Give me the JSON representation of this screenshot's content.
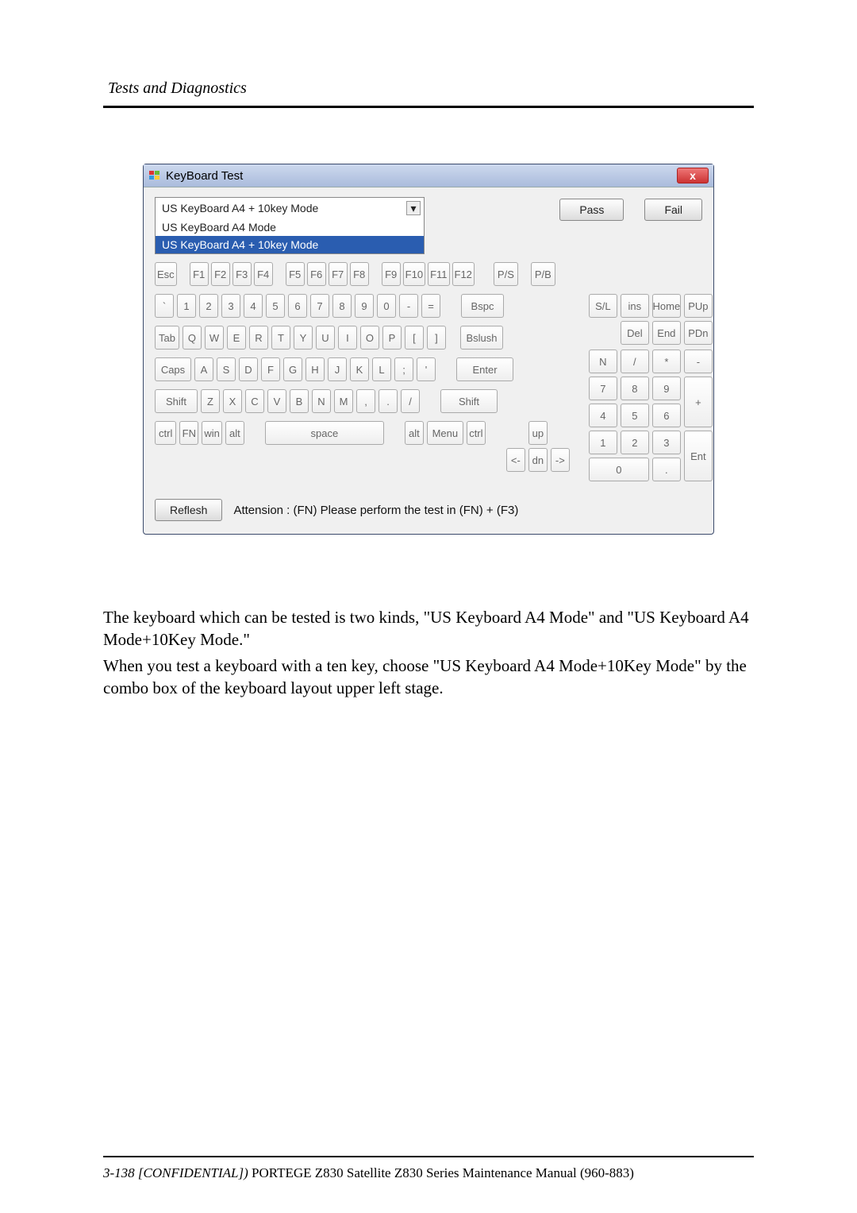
{
  "doc_header": "Tests and Diagnostics",
  "window": {
    "title": "KeyBoard Test",
    "close_label": "x"
  },
  "combo": {
    "selected": "US KeyBoard A4 + 10key Mode",
    "options": [
      {
        "label": "US KeyBoard A4 Mode",
        "selected": false
      },
      {
        "label": "US KeyBoard A4 + 10key Mode",
        "selected": true
      }
    ]
  },
  "buttons": {
    "pass": "Pass",
    "fail": "Fail",
    "reflesh": "Reflesh"
  },
  "fn_row": {
    "esc": "Esc",
    "f1": "F1",
    "f2": "F2",
    "f3": "F3",
    "f4": "F4",
    "f5": "F5",
    "f6": "F6",
    "f7": "F7",
    "f8": "F8",
    "f9": "F9",
    "f10": "F10",
    "f11": "F11",
    "f12": "F12",
    "ps": "P/S",
    "pb": "P/B"
  },
  "row1": {
    "grave": "`",
    "k1": "1",
    "k2": "2",
    "k3": "3",
    "k4": "4",
    "k5": "5",
    "k6": "6",
    "k7": "7",
    "k8": "8",
    "k9": "9",
    "k0": "0",
    "minus": "-",
    "equal": "=",
    "bspc": "Bspc"
  },
  "row2": {
    "tab": "Tab",
    "q": "Q",
    "w": "W",
    "e": "E",
    "r": "R",
    "t": "T",
    "y": "Y",
    "u": "U",
    "i": "I",
    "o": "O",
    "p": "P",
    "lbr": "[",
    "rbr": "]",
    "bsl": "Bslush"
  },
  "row3": {
    "caps": "Caps",
    "a": "A",
    "s": "S",
    "d": "D",
    "f": "F",
    "g": "G",
    "h": "H",
    "j": "J",
    "k": "K",
    "l": "L",
    "semi": ";",
    "apos": "'",
    "enter": "Enter"
  },
  "row4": {
    "lshift": "Shift",
    "z": "Z",
    "x": "X",
    "c": "C",
    "v": "V",
    "b": "B",
    "n": "N",
    "m": "M",
    "comma": ",",
    "dot": ".",
    "slash": "/",
    "rshift": "Shift"
  },
  "row5": {
    "lctrl": "ctrl",
    "fn": "FN",
    "win": "win",
    "lalt": "alt",
    "space": "space",
    "ralt": "alt",
    "menu": "Menu",
    "rctrl": "ctrl"
  },
  "arrows": {
    "up": "up",
    "left": "<-",
    "dn": "dn",
    "right": "->"
  },
  "nav": {
    "sl": "S/L",
    "ins": "ins",
    "home": "Home",
    "pup": "PUp",
    "del": "Del",
    "end": "End",
    "pdn": "PDn"
  },
  "numpad": {
    "n": "N",
    "div": "/",
    "mul": "*",
    "minus": "-",
    "k7": "7",
    "k8": "8",
    "k9": "9",
    "plus": "+",
    "k4": "4",
    "k5": "5",
    "k6": "6",
    "k1": "1",
    "k2": "2",
    "k3": "3",
    "ent": "Ent",
    "k0": "0",
    "dot": "."
  },
  "attention": "Attension : (FN) Please perform the test in (FN) + (F3)",
  "para1": "The keyboard which can be tested is two kinds, \"US Keyboard A4 Mode\" and \"US Keyboard A4 Mode+10Key Mode.\"",
  "para2": "When you test a keyboard with a ten key, choose \"US Keyboard A4 Mode+10Key Mode\" by the combo box of the keyboard layout upper left stage.",
  "footer": {
    "pagenum": "3-138 [CONFIDENTIAL])",
    "rest": " PORTEGE Z830 Satellite Z830 Series Maintenance Manual (960-883)"
  }
}
